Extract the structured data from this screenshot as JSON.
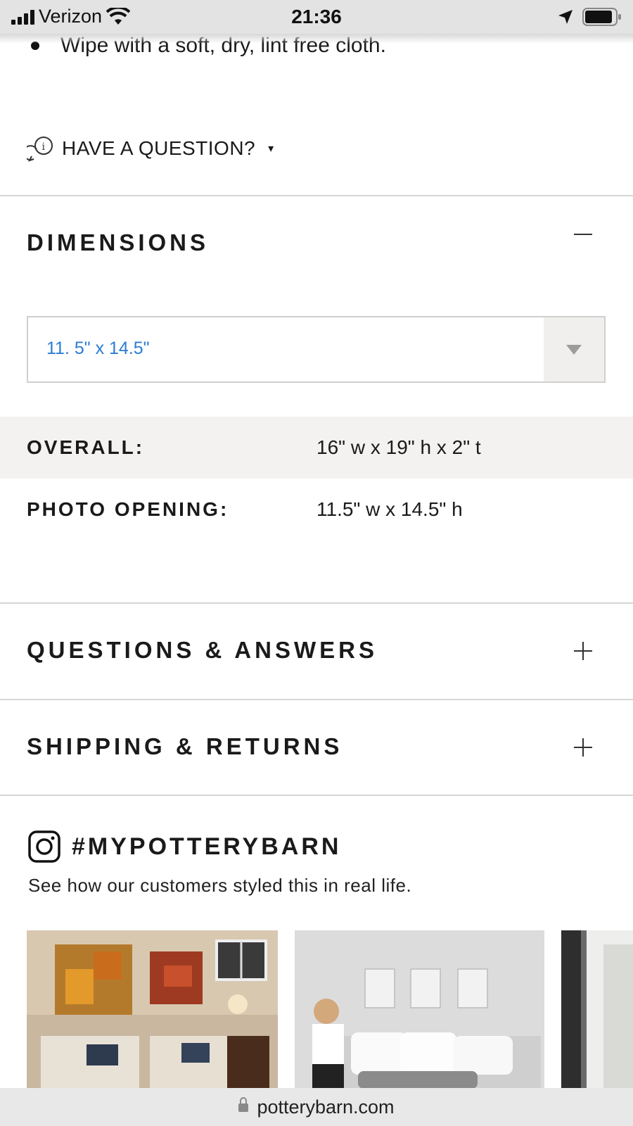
{
  "status_bar": {
    "carrier": "Verizon",
    "time": "21:36"
  },
  "care": {
    "bullet": "Wipe with a soft, dry, lint free cloth."
  },
  "question": {
    "label": "HAVE A QUESTION?",
    "indicator": "▾"
  },
  "dimensions": {
    "title": "DIMENSIONS",
    "toggle": "collapse",
    "selected_size": "11. 5\" x 14.5\"",
    "rows": [
      {
        "label": "OVERALL:",
        "value": "16\" w x 19\" h x 2\" t"
      },
      {
        "label": "PHOTO OPENING:",
        "value": "11.5\" w x 14.5\" h"
      }
    ]
  },
  "sections": {
    "qa": "QUESTIONS & ANSWERS",
    "shipping": "SHIPPING & RETURNS"
  },
  "instagram": {
    "title": "#MYPOTTERYBARN",
    "subtitle": "See how our customers styled this in real life."
  },
  "url_bar": {
    "domain": "potterybarn.com"
  },
  "icons": {
    "question": "chat-info-icon",
    "expand": "plus-icon",
    "collapse": "minus-icon",
    "instagram": "instagram-icon",
    "lock": "lock-icon"
  }
}
